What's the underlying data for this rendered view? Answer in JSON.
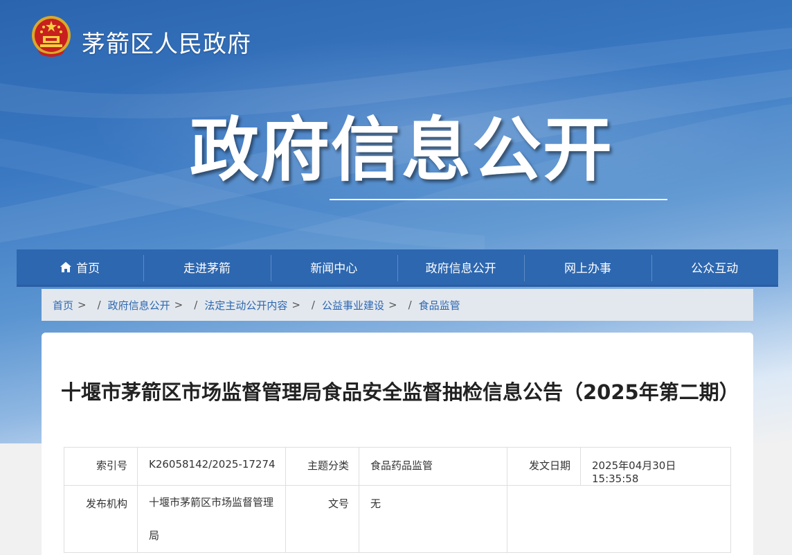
{
  "header": {
    "site_name": "茅箭区人民政府",
    "banner_title": "政府信息公开",
    "emblem_icon": "national-emblem-icon"
  },
  "nav": {
    "items": [
      {
        "label": "首页",
        "icon": "home-icon"
      },
      {
        "label": "走进茅箭"
      },
      {
        "label": "新闻中心"
      },
      {
        "label": "政府信息公开"
      },
      {
        "label": "网上办事"
      },
      {
        "label": "公众互动"
      }
    ]
  },
  "breadcrumb": {
    "items": [
      "首页",
      "政府信息公开",
      "法定主动公开内容",
      "公益事业建设",
      "食品监管"
    ],
    "separator": "/"
  },
  "article": {
    "title": "十堰市茅箭区市场监督管理局食品安全监督抽检信息公告（2025年第二期）"
  },
  "meta": {
    "index_label": "索引号",
    "index_value": "K26058142/2025-17274",
    "topic_label": "主题分类",
    "topic_value": "食品药品监管",
    "date_label": "发文日期",
    "date_value": "2025年04月30日 15:35:58",
    "org_label": "发布机构",
    "org_value": "十堰市茅箭区市场监督管理局",
    "docno_label": "文号",
    "docno_value": "无"
  },
  "colors": {
    "nav_bg": "#2d67b0",
    "link": "#2d67b0",
    "banner_top": "#2b64ae"
  }
}
